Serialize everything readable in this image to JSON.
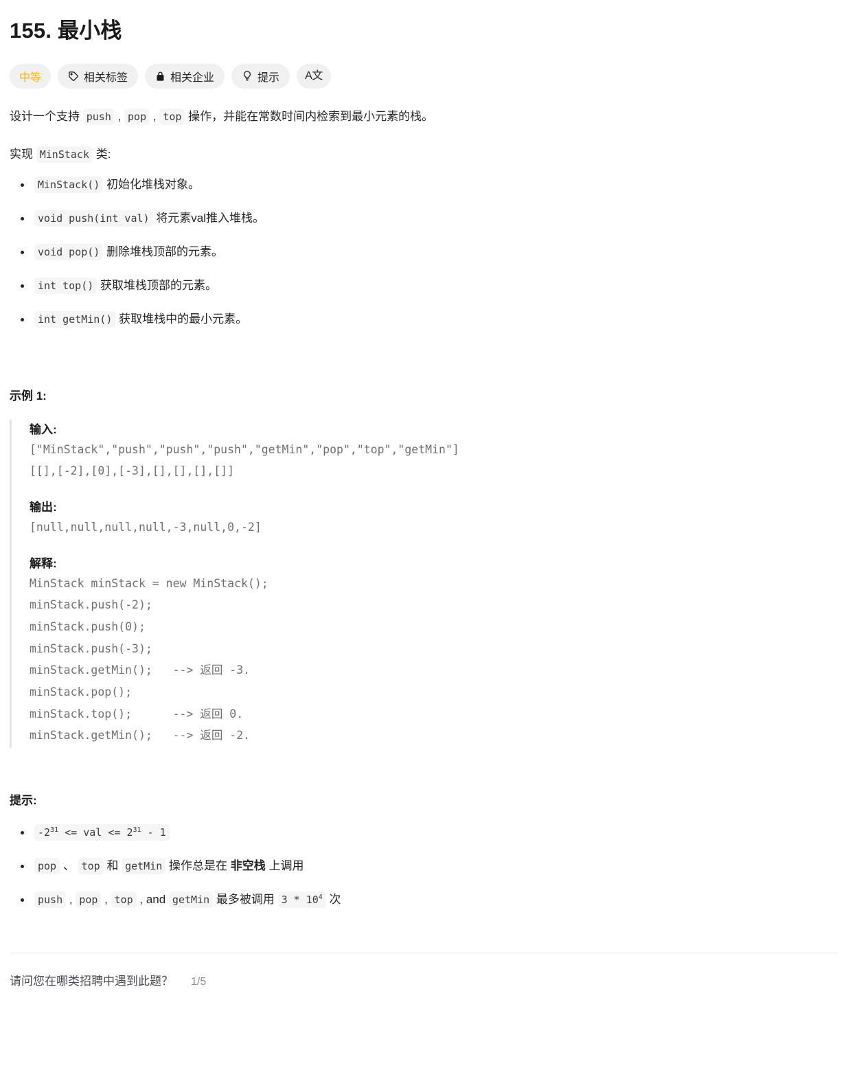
{
  "problem": {
    "title": "155. 最小栈",
    "badges": [
      {
        "name": "difficulty",
        "label": "中等",
        "icon": "none"
      },
      {
        "name": "related-topics",
        "label": "相关标签",
        "icon": "tag-icon"
      },
      {
        "name": "related-companies",
        "label": "相关企业",
        "icon": "lock-icon"
      },
      {
        "name": "hint",
        "label": "提示",
        "icon": "lightbulb-icon"
      },
      {
        "name": "translate",
        "label": "A文",
        "icon": "translate-icon"
      }
    ],
    "difficulty_color": "#ffb700",
    "intro": {
      "prefix": "设计一个支持 ",
      "code1": "push",
      "sep1": " , ",
      "code2": "pop",
      "sep2": " , ",
      "code3": "top",
      "suffix": " 操作，并能在常数时间内检索到最小元素的栈。"
    },
    "implement": {
      "prefix": "实现 ",
      "code": "MinStack",
      "suffix": " 类:"
    },
    "methods": [
      {
        "code": "MinStack()",
        "desc": " 初始化堆栈对象。"
      },
      {
        "code": "void push(int val)",
        "desc": " 将元素val推入堆栈。"
      },
      {
        "code": "void pop()",
        "desc": " 删除堆栈顶部的元素。"
      },
      {
        "code": "int top()",
        "desc": " 获取堆栈顶部的元素。"
      },
      {
        "code": "int getMin()",
        "desc": " 获取堆栈中的最小元素。"
      }
    ],
    "example": {
      "heading": "示例 1:",
      "input_label": "输入:",
      "input_text": "[\"MinStack\",\"push\",\"push\",\"push\",\"getMin\",\"pop\",\"top\",\"getMin\"]\n[[],[-2],[0],[-3],[],[],[],[]]",
      "output_label": "输出:",
      "output_text": "[null,null,null,null,-3,null,0,-2]",
      "explain_label": "解释:",
      "explain_text": "MinStack minStack = new MinStack();\nminStack.push(-2);\nminStack.push(0);\nminStack.push(-3);\nminStack.getMin();   --> 返回 -3.\nminStack.pop();\nminStack.top();      --> 返回 0.\nminStack.getMin();   --> 返回 -2."
    },
    "constraints": {
      "heading": "提示:",
      "items": [
        {
          "kind": "code_only",
          "code_pre": "-2",
          "sup1": "31",
          "code_mid": " <= val <= 2",
          "sup2": "31",
          "code_post": " - 1"
        },
        {
          "kind": "mixed2",
          "c1": "pop",
          "t1": " 、 ",
          "c2": "top",
          "t2": " 和 ",
          "c3": "getMin",
          "t3": " 操作总是在 ",
          "bold": "非空栈",
          "t4": " 上调用"
        },
        {
          "kind": "mixed3",
          "c1": "push",
          "t1": " , ",
          "c2": "pop",
          "t2": " , ",
          "c3": "top",
          "t3": " , and ",
          "c4": "getMin",
          "t4": " 最多被调用 ",
          "c5_pre": "3 * 10",
          "c5_sup": "4",
          "t5": " 次"
        }
      ]
    }
  },
  "footer": {
    "survey_question": "请问您在哪类招聘中遇到此题？",
    "survey_count": "1/5"
  }
}
